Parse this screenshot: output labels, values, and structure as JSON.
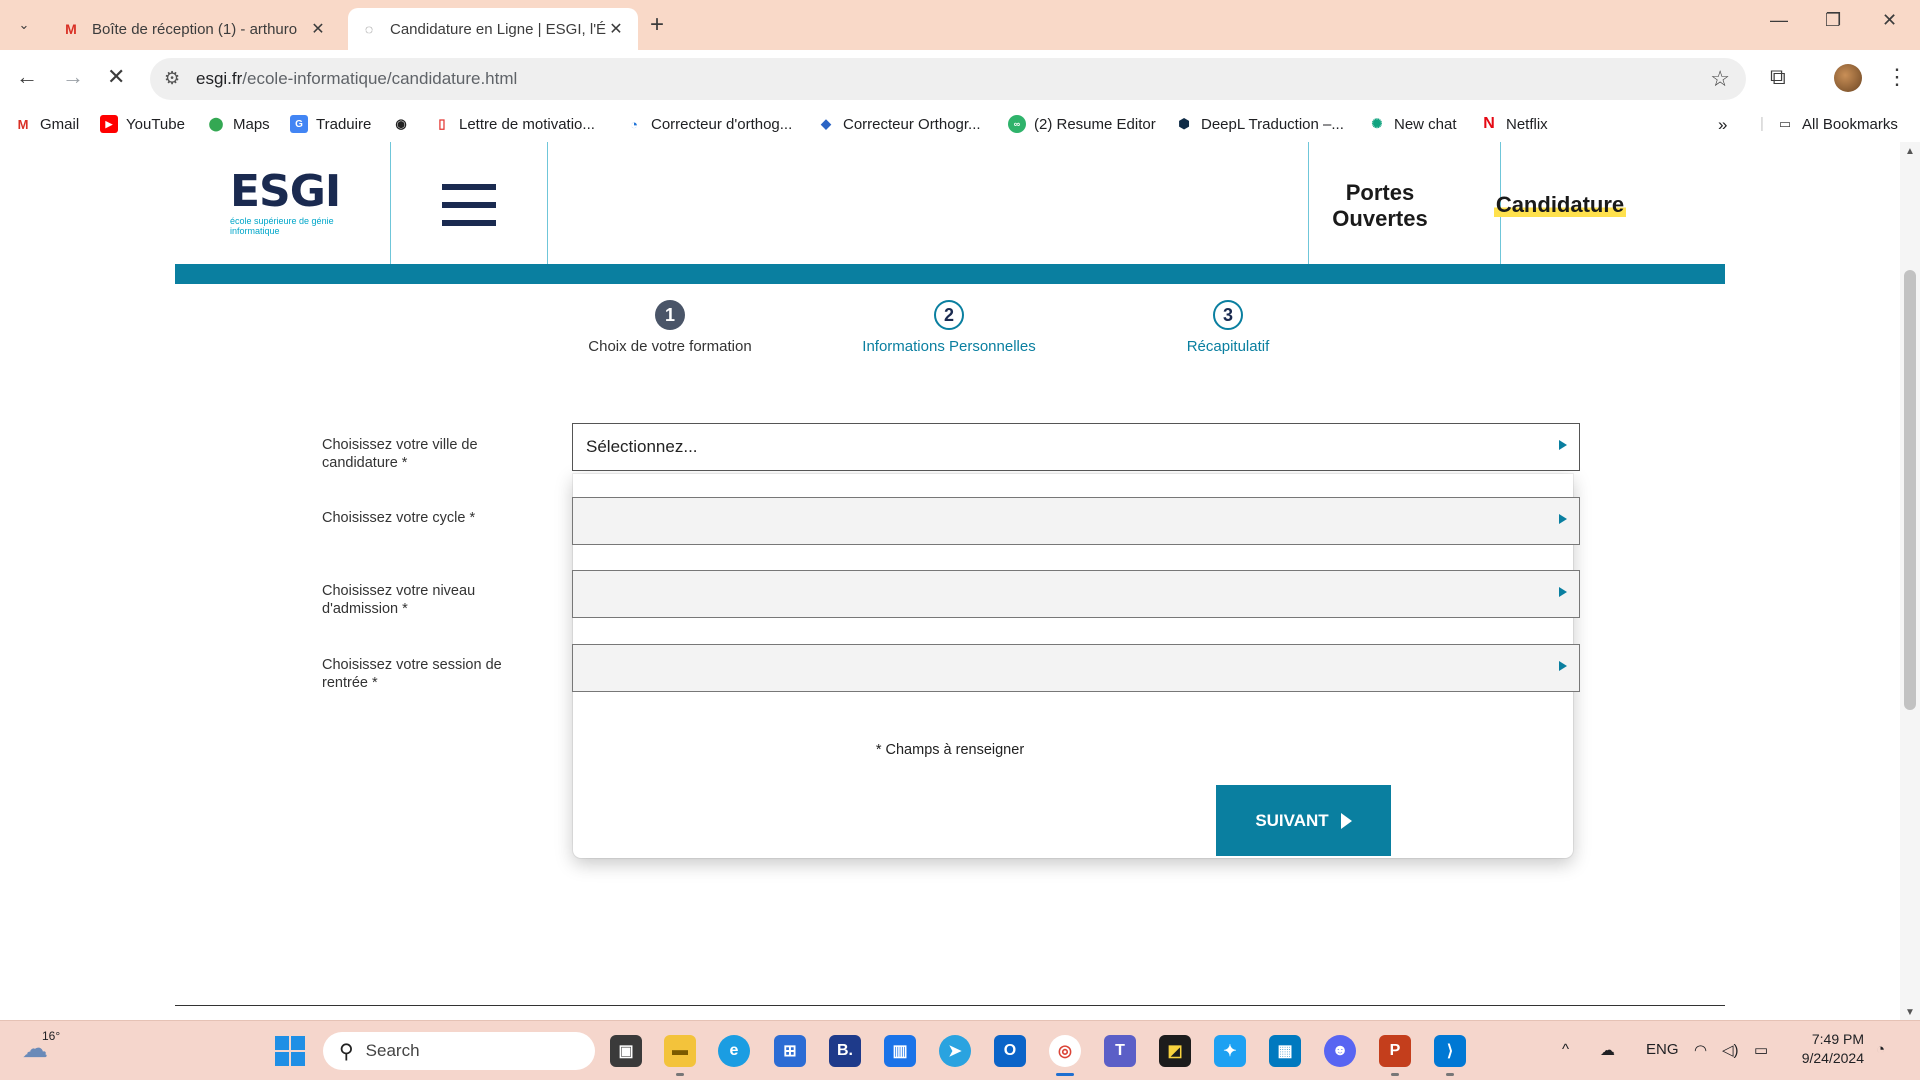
{
  "browser": {
    "tabs": [
      {
        "title": "Boîte de réception (1) - arthuro",
        "favicon": "gmail-icon",
        "active": false
      },
      {
        "title": "Candidature en Ligne | ESGI, l'É",
        "favicon": "loading-icon",
        "active": true
      }
    ],
    "url_host": "esgi.fr",
    "url_path": "/ecole-informatique/candidature.html",
    "bookmarks": [
      {
        "label": "Gmail",
        "icon": "gmail-icon"
      },
      {
        "label": "YouTube",
        "icon": "youtube-icon"
      },
      {
        "label": "Maps",
        "icon": "maps-icon"
      },
      {
        "label": "Traduire",
        "icon": "translate-icon"
      },
      {
        "label": "",
        "icon": "globe-icon"
      },
      {
        "label": "Lettre de motivatio...",
        "icon": "doc-icon"
      },
      {
        "label": "Correcteur d'orthog...",
        "icon": "spellcheck-icon"
      },
      {
        "label": "Correcteur Orthogr...",
        "icon": "spellcheck2-icon"
      },
      {
        "label": "(2) Resume Editor",
        "icon": "resume-icon"
      },
      {
        "label": "DeepL Traduction –...",
        "icon": "deepl-icon"
      },
      {
        "label": "New chat",
        "icon": "chatgpt-icon"
      },
      {
        "label": "Netflix",
        "icon": "netflix-icon"
      }
    ],
    "all_bookmarks": "All Bookmarks"
  },
  "site": {
    "logo_word": "ESGI",
    "logo_tag": "école supérieure de génie informatique",
    "portes_ouvertes": "Portes Ouvertes",
    "candidature": "Candidature"
  },
  "steps": [
    {
      "number": "1",
      "label": "Choix de votre formation",
      "active": true
    },
    {
      "number": "2",
      "label": "Informations Personnelles",
      "active": false
    },
    {
      "number": "3",
      "label": "Récapitulatif",
      "active": false
    }
  ],
  "form": {
    "fields": [
      {
        "label": "Choisissez votre ville de candidature *",
        "value": "Sélectionnez..."
      },
      {
        "label": "Choisissez votre cycle *",
        "value": ""
      },
      {
        "label": "Choisissez votre niveau d'admission *",
        "value": ""
      },
      {
        "label": "Choisissez votre session de rentrée *",
        "value": ""
      }
    ],
    "required_note": "* Champs à renseigner",
    "next_label": "SUIVANT"
  },
  "taskbar": {
    "temperature": "16°",
    "search_placeholder": "Search",
    "language": "ENG",
    "time": "7:49 PM",
    "date": "9/24/2024"
  },
  "colors": {
    "accent": "#0a7fa0",
    "brand_navy": "#1a2a50",
    "highlight": "#ffe14d"
  }
}
